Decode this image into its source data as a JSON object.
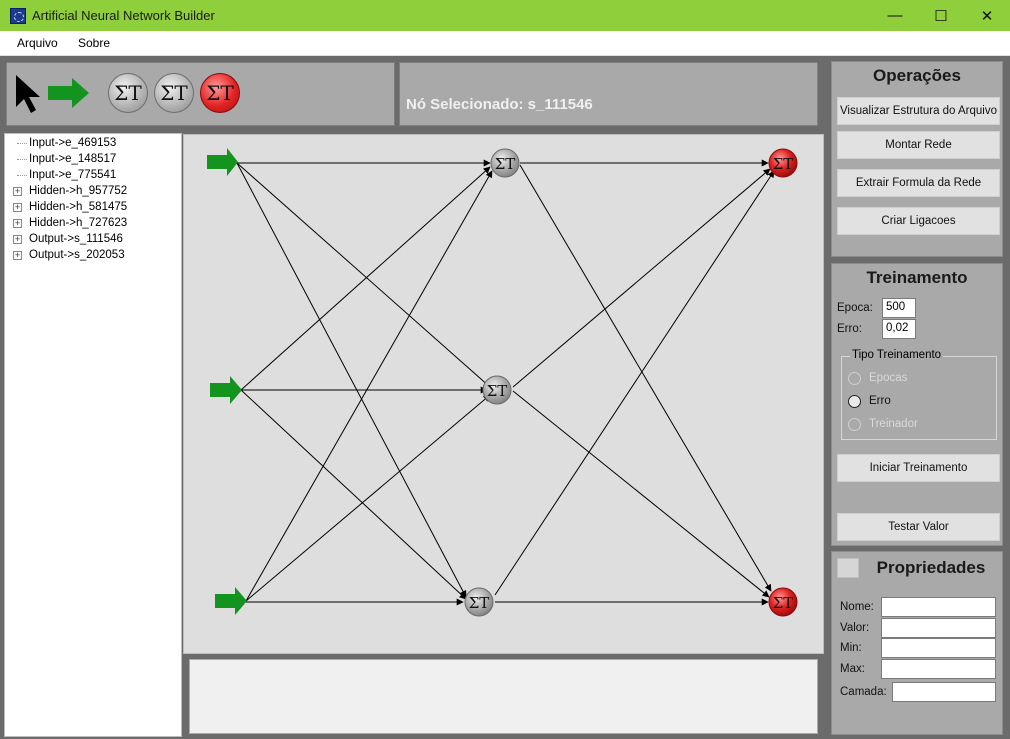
{
  "window": {
    "title": "Artificial Neural Network Builder",
    "minimize": "—",
    "maximize": "☐",
    "close": "✕"
  },
  "menu": {
    "items": [
      "Arquivo",
      "Sobre"
    ]
  },
  "toolbox": {
    "tools": [
      {
        "name": "pointer-icon"
      },
      {
        "name": "input-arrow-icon",
        "color": "#12941f"
      },
      {
        "name": "sigma-node-icon",
        "label": "ΣT"
      },
      {
        "name": "sigma-node-icon",
        "label": "ΣT"
      },
      {
        "name": "sigma-output-node-icon",
        "label": "ΣT",
        "color": "#e22424"
      }
    ]
  },
  "selected_node": {
    "label": "Nó Selecionado: s_111546"
  },
  "tree": {
    "items": [
      {
        "label": "Input->e_469153",
        "expandable": false
      },
      {
        "label": "Input->e_148517",
        "expandable": false
      },
      {
        "label": "Input->e_775541",
        "expandable": false
      },
      {
        "label": "Hidden->h_957752",
        "expandable": true
      },
      {
        "label": "Hidden->h_581475",
        "expandable": true
      },
      {
        "label": "Hidden->h_727623",
        "expandable": true
      },
      {
        "label": "Output->s_111546",
        "expandable": true
      },
      {
        "label": "Output->s_202053",
        "expandable": true
      }
    ]
  },
  "network": {
    "node_label": "ΣT",
    "input_arrow_color": "#12941f",
    "output_color": "#e22424",
    "hidden_color": "#a6a6a6"
  },
  "operacoes": {
    "title": "Operações",
    "buttons": [
      "Visualizar Estrutura do Arquivo",
      "Montar Rede",
      "Extrair Formula da Rede",
      "Criar Ligacoes"
    ]
  },
  "treinamento": {
    "title": "Treinamento",
    "epoca_label": "Epoca:",
    "epoca_value": "500",
    "erro_label": "Erro:",
    "erro_value": "0,02",
    "tipo_title": "Tipo Treinamento",
    "options": [
      "Epocas",
      "Erro",
      "Treinador"
    ],
    "selected_option": "Erro",
    "start_button": "Iniciar Treinamento",
    "test_button": "Testar Valor"
  },
  "propriedades": {
    "title": "Propriedades",
    "fields": [
      {
        "label": "Nome:",
        "value": ""
      },
      {
        "label": "Valor:",
        "value": ""
      },
      {
        "label": "Min:",
        "value": ""
      },
      {
        "label": "Max:",
        "value": ""
      },
      {
        "label": "Camada:",
        "value": ""
      }
    ]
  }
}
